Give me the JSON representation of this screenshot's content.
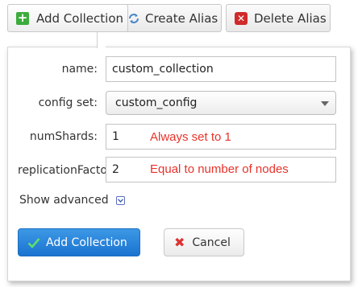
{
  "toolbar": {
    "add_collection_label": "Add Collection",
    "create_alias_label": "Create Alias",
    "delete_alias_label": "Delete Alias"
  },
  "form": {
    "name_label": "name:",
    "name_value": "custom_collection",
    "config_set_label": "config set:",
    "config_set_value": "custom_config",
    "num_shards_label": "numShards:",
    "num_shards_value": "1",
    "num_shards_note": "Always set to 1",
    "replication_label": "replicationFacto",
    "replication_value": "2",
    "replication_note": "Equal to number of nodes",
    "show_advanced_label": "Show advanced",
    "submit_label": "Add Collection",
    "cancel_label": "Cancel"
  },
  "icons": {
    "add": "plus-icon",
    "alias": "sync-icon",
    "delete": "delete-icon",
    "advanced": "chevron-down-icon",
    "submit": "check-icon",
    "cancel": "close-icon"
  },
  "colors": {
    "annotation": "#e8332b",
    "primary_button": "#1a73cf",
    "add_icon": "#3cac3c",
    "delete_icon": "#d02a2a"
  }
}
